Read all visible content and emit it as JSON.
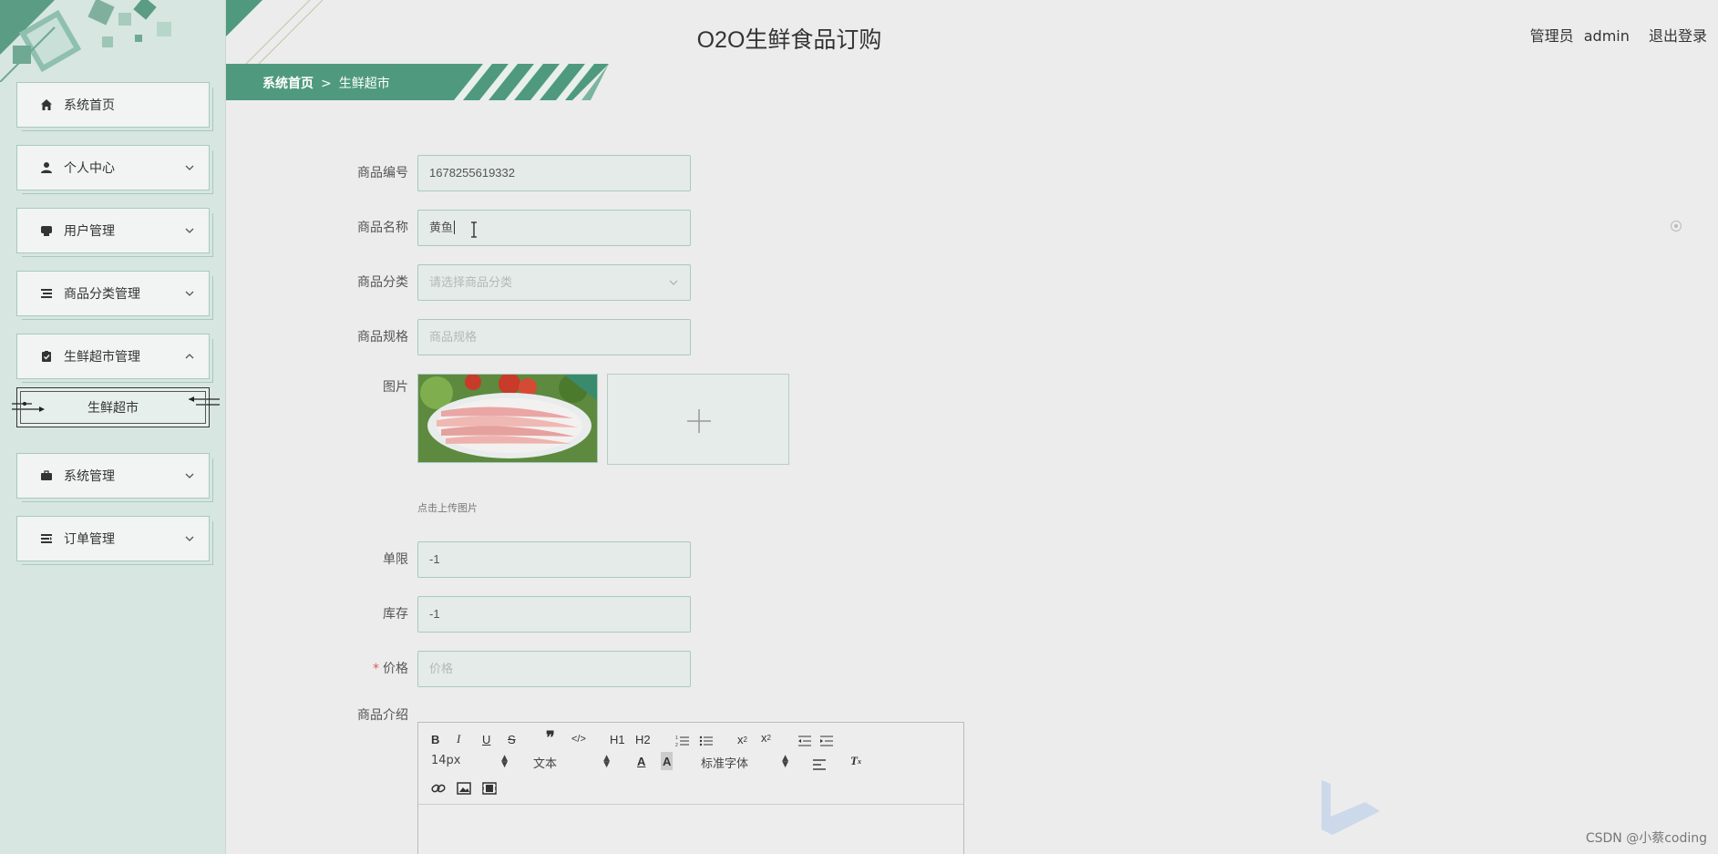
{
  "header": {
    "app_title": "O2O生鲜食品订购",
    "user_role": "管理员",
    "username": "admin",
    "logout": "退出登录"
  },
  "breadcrumb": {
    "home": "系统首页",
    "separator": ">",
    "current": "生鲜超市"
  },
  "sidebar": {
    "items": [
      {
        "label": "系统首页",
        "icon": "home-icon",
        "expandable": false
      },
      {
        "label": "个人中心",
        "icon": "user-icon",
        "expandable": true
      },
      {
        "label": "用户管理",
        "icon": "users-icon",
        "expandable": true
      },
      {
        "label": "商品分类管理",
        "icon": "list-icon",
        "expandable": true
      },
      {
        "label": "生鲜超市管理",
        "icon": "clipboard-icon",
        "expandable": true,
        "expanded": true
      },
      {
        "label": "系统管理",
        "icon": "briefcase-icon",
        "expandable": true
      },
      {
        "label": "订单管理",
        "icon": "order-icon",
        "expandable": true
      }
    ],
    "subitem": "生鲜超市"
  },
  "form": {
    "code_label": "商品编号",
    "code_value": "1678255619332",
    "name_label": "商品名称",
    "name_value": "黄鱼",
    "category_label": "商品分类",
    "category_placeholder": "请选择商品分类",
    "spec_label": "商品规格",
    "spec_placeholder": "商品规格",
    "image_label": "图片",
    "upload_hint": "点击上传图片",
    "limit_label": "单限",
    "limit_value": "-1",
    "stock_label": "库存",
    "stock_value": "-1",
    "price_required": "*",
    "price_label": "价格",
    "price_placeholder": "价格",
    "intro_label": "商品介绍"
  },
  "editor": {
    "font_size": "14px",
    "paragraph": "文本",
    "font_family": "标准字体",
    "h1": "H1",
    "h2": "H2"
  },
  "watermark": "CSDN @小蔡coding",
  "colors": {
    "accent": "#4f9a7e",
    "sidebar_bg": "#d7e6e1",
    "page_bg": "#ececec",
    "input_border": "#a9c9bf"
  }
}
